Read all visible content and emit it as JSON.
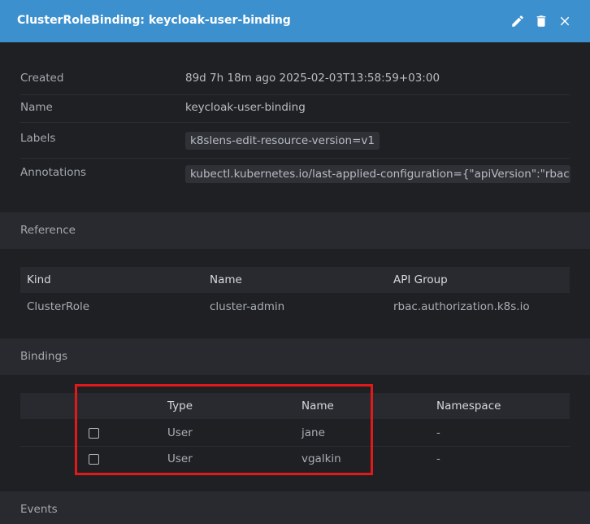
{
  "header": {
    "title": "ClusterRoleBinding: keycloak-user-binding",
    "bg_color": "#3d90ce"
  },
  "details": {
    "created_label": "Created",
    "created_value": "89d 7h 18m ago 2025-02-03T13:58:59+03:00",
    "name_label": "Name",
    "name_value": "keycloak-user-binding",
    "labels_label": "Labels",
    "labels_value": "k8slens-edit-resource-version=v1",
    "annotations_label": "Annotations",
    "annotations_value": "kubectl.kubernetes.io/last-applied-configuration={\"apiVersion\":\"rbac...."
  },
  "reference": {
    "title": "Reference",
    "columns": [
      "Kind",
      "Name",
      "API Group"
    ],
    "row": [
      "ClusterRole",
      "cluster-admin",
      "rbac.authorization.k8s.io"
    ]
  },
  "bindings": {
    "title": "Bindings",
    "columns": [
      "Type",
      "Name",
      "Namespace"
    ],
    "rows": [
      {
        "type": "User",
        "name": "jane",
        "namespace": "-"
      },
      {
        "type": "User",
        "name": "vgalkin",
        "namespace": "-"
      }
    ],
    "highlight_color": "#e0191b"
  },
  "events": {
    "title": "Events"
  }
}
